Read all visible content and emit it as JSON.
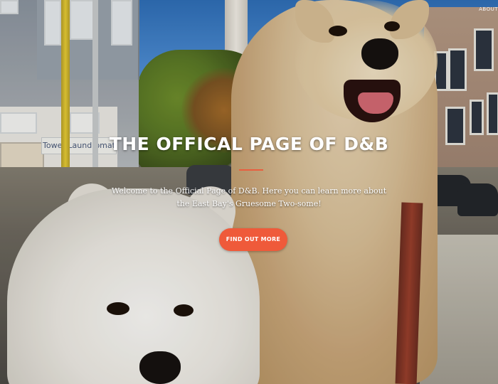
{
  "nav": {
    "about_label": "ABOUT"
  },
  "hero": {
    "title": "THE OFFICAL PAGE OF D&B",
    "subtitle": "Welcome to the Official Page of D&B. Here you can learn more about the East Bay's Gruesome Two-some!",
    "cta_label": "FIND OUT MORE"
  },
  "background": {
    "shop_sign_text": "Tower Laundromat"
  },
  "colors": {
    "accent": "#ef5a3a",
    "rule": "#e95e3f",
    "text": "#ffffff"
  }
}
